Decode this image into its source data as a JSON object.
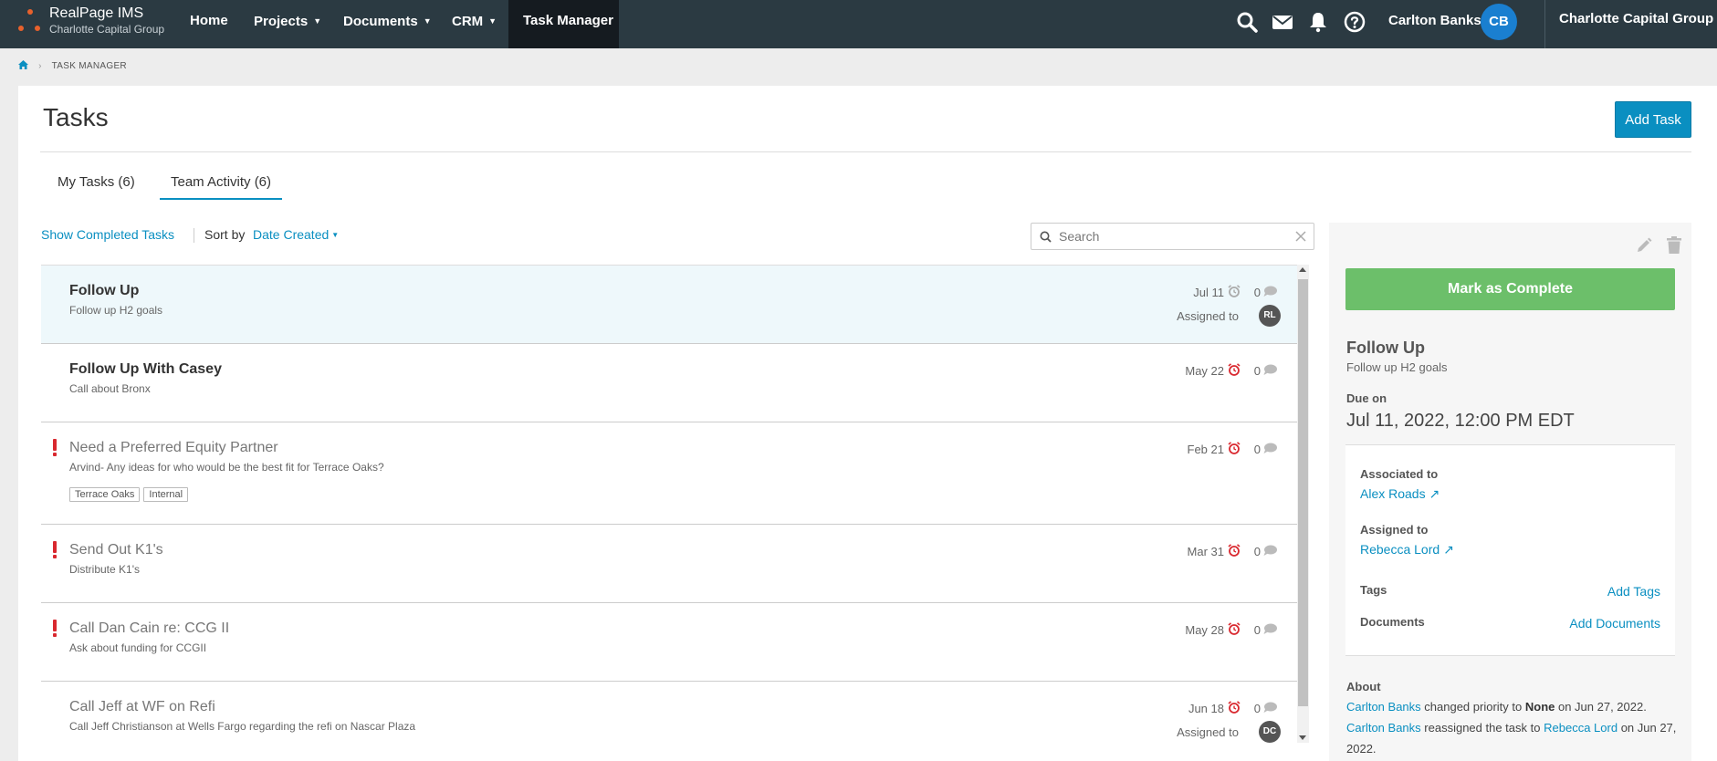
{
  "brand": {
    "title": "RealPage IMS",
    "subtitle": "Charlotte Capital Group"
  },
  "nav": {
    "items": [
      {
        "label": "Home"
      },
      {
        "label": "Projects"
      },
      {
        "label": "Documents"
      },
      {
        "label": "CRM"
      },
      {
        "label": "Task Manager"
      }
    ],
    "user_name": "Carlton Banks",
    "user_initials": "CB",
    "org": "Charlotte Capital Group",
    "icons": [
      "search-icon",
      "mail-icon",
      "bell-icon",
      "help-icon"
    ]
  },
  "breadcrumb": {
    "current": "TASK MANAGER"
  },
  "page": {
    "title": "Tasks",
    "add_task_label": "Add Task"
  },
  "tabs": [
    {
      "label": "My Tasks (6)"
    },
    {
      "label": "Team Activity (6)"
    }
  ],
  "toolbar": {
    "show_completed": "Show Completed Tasks",
    "sort_label": "Sort by",
    "sort_value": "Date Created",
    "search_placeholder": "Search"
  },
  "tasks": [
    {
      "title": "Follow Up",
      "desc": "Follow up H2 goals",
      "date": "Jul 11",
      "comments": "0",
      "assigned_label": "Assigned to",
      "assignee": "RL"
    },
    {
      "title": "Follow Up With Casey",
      "desc": "Call about Bronx",
      "date": "May 22",
      "comments": "0"
    },
    {
      "title": "Need a Preferred Equity Partner",
      "desc": "Arvind- Any ideas for who would be the best fit for Terrace Oaks?",
      "date": "Feb 21",
      "comments": "0",
      "tags": [
        "Terrace Oaks",
        "Internal"
      ]
    },
    {
      "title": "Send Out K1's",
      "desc": "Distribute K1's",
      "date": "Mar 31",
      "comments": "0"
    },
    {
      "title": "Call Dan Cain re: CCG II",
      "desc": "Ask about funding for CCGII",
      "date": "May 28",
      "comments": "0"
    },
    {
      "title": "Call Jeff at WF on Refi",
      "desc": "Call Jeff Christianson at Wells Fargo regarding the refi on Nascar Plaza",
      "date": "Jun 18",
      "comments": "0",
      "assigned_label": "Assigned to",
      "assignee": "DC"
    }
  ],
  "detail": {
    "complete_label": "Mark as Complete",
    "title": "Follow Up",
    "desc": "Follow up H2 goals",
    "due_label": "Due on",
    "due": "Jul 11, 2022, 12:00 PM EDT",
    "associated_label": "Associated to",
    "associated": "Alex Roads",
    "assigned_label": "Assigned to",
    "assigned": "Rebecca Lord",
    "tags_label": "Tags",
    "add_tags": "Add Tags",
    "documents_label": "Documents",
    "add_documents": "Add Documents",
    "about_label": "About",
    "activity": [
      {
        "user": "Carlton Banks",
        "action": "changed priority to",
        "value": "None",
        "suffix": "on Jun 27, 2022."
      },
      {
        "user": "Carlton Banks",
        "action": "reassigned the task to",
        "value": "Rebecca Lord",
        "suffix": "on Jun 27, 2022."
      }
    ]
  },
  "colors": {
    "nav_bg": "#2b3a42",
    "accent": "#0a8fc1",
    "complete": "#6cbf6a",
    "priority": "#d9282f",
    "brand_dot": "#e8612c"
  }
}
